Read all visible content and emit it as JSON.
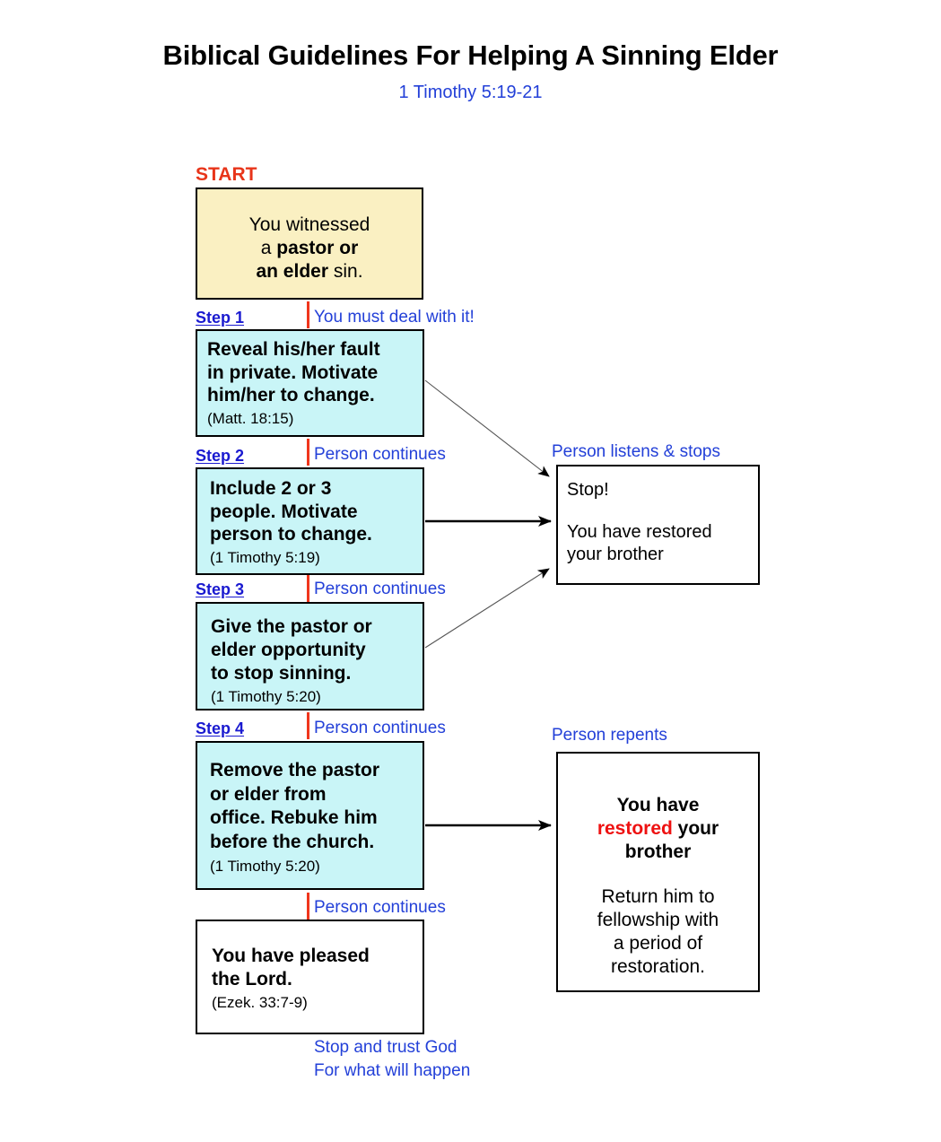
{
  "header": {
    "title": "Biblical Guidelines For Helping A Sinning Elder",
    "subtitle": "1 Timothy 5:19-21"
  },
  "colors": {
    "start_label": "#e8351a",
    "step_label": "#1a1ad0",
    "annotation": "#2340d8",
    "highlight_red": "#ee1111",
    "start_box_fill": "#faf0c2",
    "step_box_fill": "#c9f5f7",
    "outcome_box_fill": "#ffffff",
    "connector_red": "#f0361c",
    "border": "#000000"
  },
  "labels": {
    "start": "START",
    "step1": "Step 1",
    "step2": "Step  2",
    "step3": "Step 3",
    "step4": "Step  4",
    "edge_deal_with_it": "You must deal with it!",
    "edge_continues_1": "Person continues",
    "edge_continues_2": "Person continues",
    "edge_continues_3": "Person continues",
    "edge_continues_4": "Person continues",
    "edge_listens_stops": "Person listens & stops",
    "edge_repents": "Person repents"
  },
  "nodes": {
    "start_box": {
      "line1": "You witnessed",
      "line2_plain": "a ",
      "line2_bold": "pastor or",
      "line3_bold": "an elder",
      "line3_plain": " sin."
    },
    "step1_box": {
      "main": "Reveal his/her fault\nin private. Motivate\nhim/her to change.",
      "ref": "(Matt. 18:15)"
    },
    "step2_box": {
      "main": "Include 2 or 3\npeople.  Motivate\nperson to change.",
      "ref": "(1 Timothy 5:19)"
    },
    "step3_box": {
      "main": "Give the pastor or\nelder opportunity\nto stop sinning.",
      "ref": "(1 Timothy 5:20)"
    },
    "step4_box": {
      "main": "Remove the pastor\nor elder from\noffice. Rebuke him\nbefore the church.",
      "ref": "(1 Timothy 5:20)"
    },
    "final_box": {
      "main": "You have pleased\nthe Lord.",
      "ref": "(Ezek. 33:7-9)"
    },
    "stop_box": {
      "line1": "Stop!",
      "line2": "You have restored\nyour brother"
    },
    "restored_box": {
      "head_pre": "You have\n",
      "head_red": "restored",
      "head_post": " your\nbrother",
      "body": "Return him to\nfellowship with\na period of\nrestoration."
    }
  },
  "footer": {
    "line1": "Stop and trust God",
    "line2": "For what will happen"
  }
}
